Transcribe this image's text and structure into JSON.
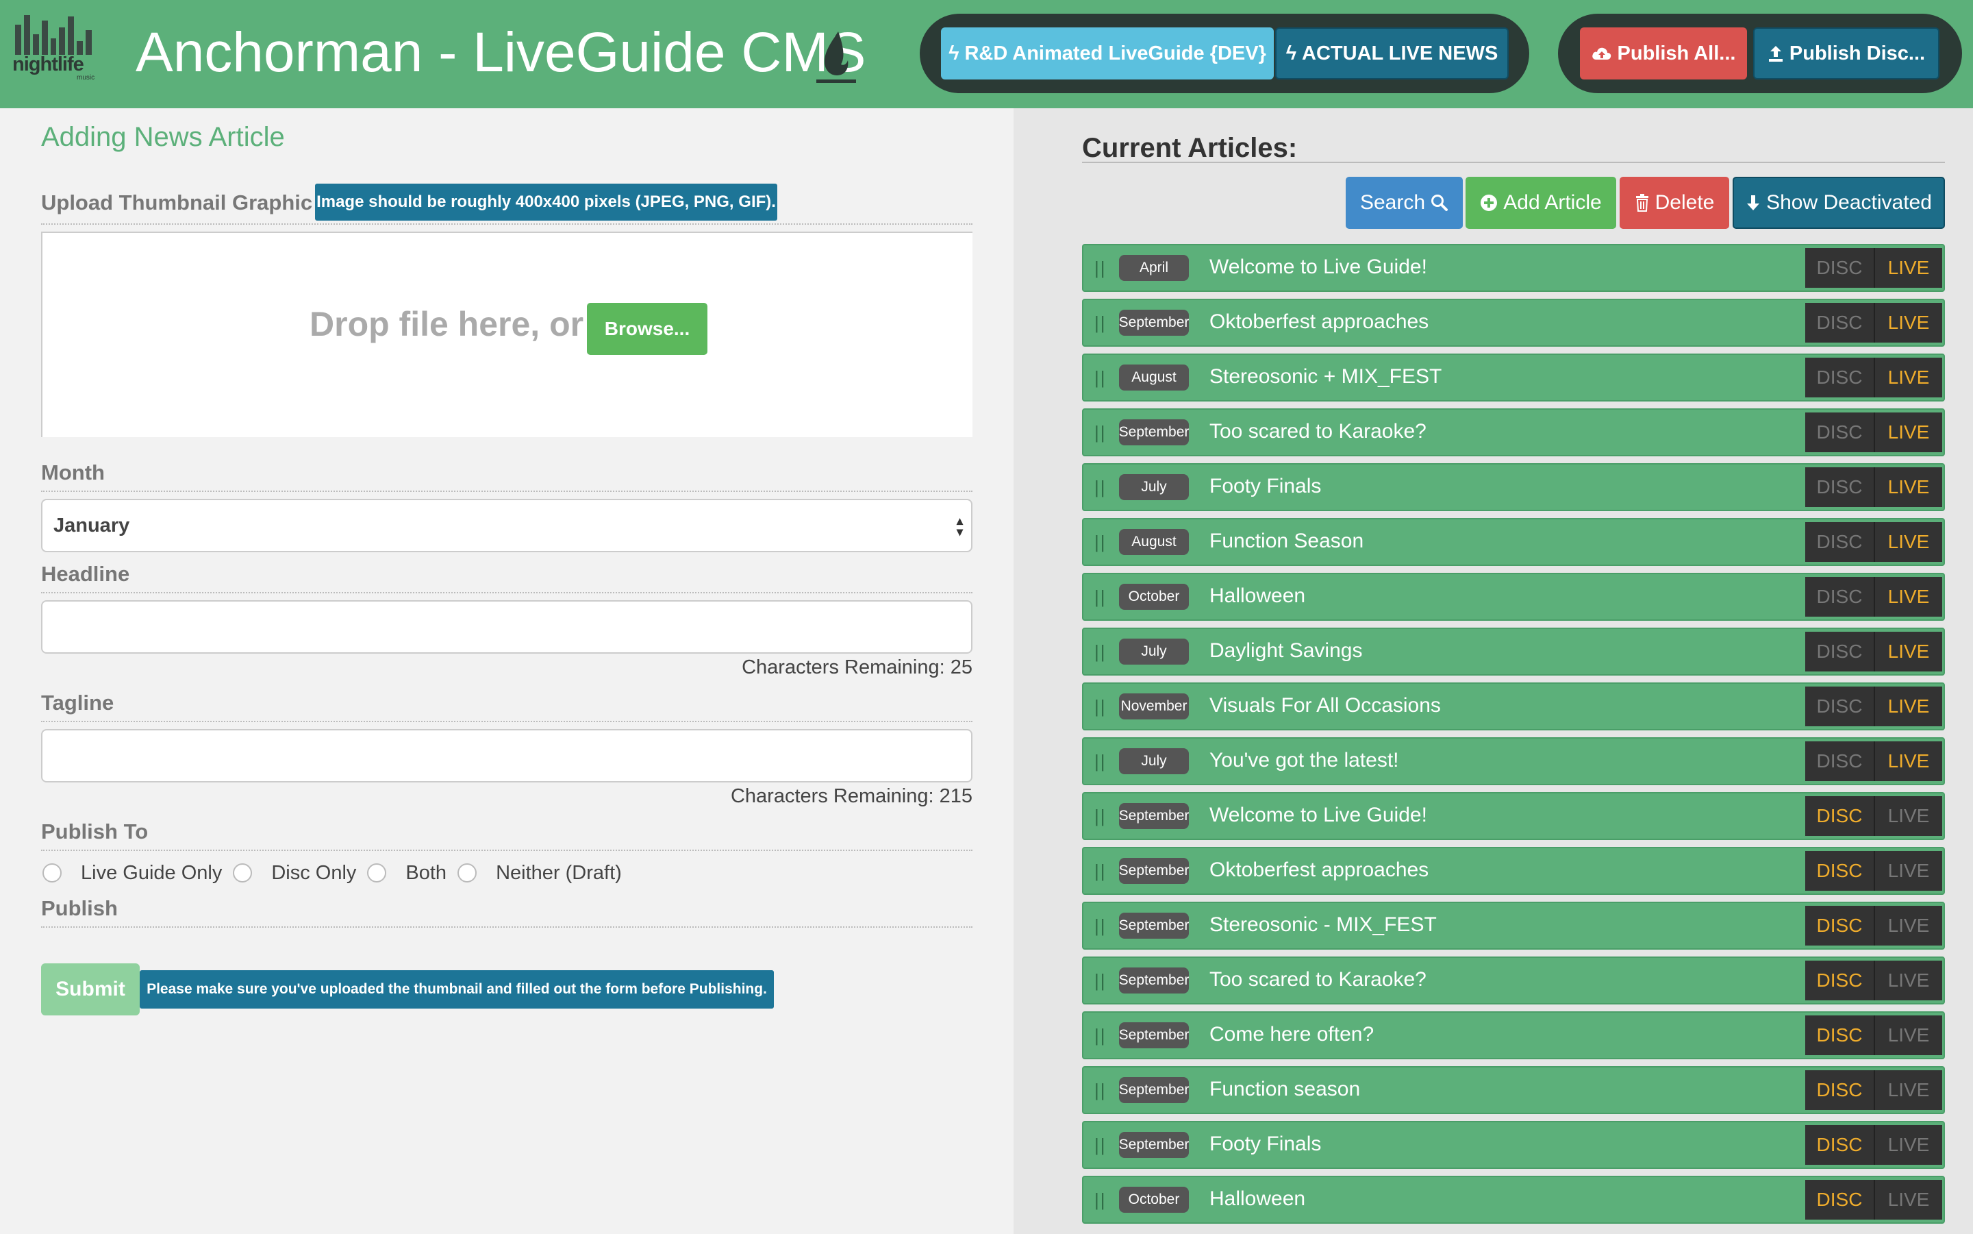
{
  "header": {
    "logo_word": "nightlife",
    "logo_sub": "music",
    "title": "Anchorman - LiveGuide CMS",
    "btn_rd": "R&D Animated LiveGuide {DEV}",
    "btn_live": "ACTUAL LIVE NEWS",
    "btn_publish_all": "Publish All...",
    "btn_publish_disc": "Publish Disc..."
  },
  "form": {
    "title": "Adding News Article",
    "thumb_label": "Upload Thumbnail Graphic",
    "thumb_tip": "Image should be roughly 400x400 pixels (JPEG, PNG, GIF).",
    "drop_text": "Drop file here, or",
    "browse_label": "Browse...",
    "month_label": "Month",
    "month_value": "January",
    "headline_label": "Headline",
    "headline_remaining": "Characters Remaining: 25",
    "tagline_label": "Tagline",
    "tagline_remaining": "Characters Remaining: 215",
    "publish_to_label": "Publish To",
    "options": [
      "Live Guide Only",
      "Disc Only",
      "Both",
      "Neither (Draft)"
    ],
    "publish_label": "Publish",
    "submit_label": "Submit",
    "submit_tip": "Please make sure you've uploaded the thumbnail and filled out the form before Publishing."
  },
  "articles_panel": {
    "title": "Current Articles:",
    "search": "Search",
    "add": "Add Article",
    "delete": "Delete",
    "show_deactivated": "Show Deactivated",
    "disc_label": "DISC",
    "live_label": "LIVE",
    "items": [
      {
        "month": "April",
        "headline": "Welcome to Live Guide!",
        "disc": false,
        "live": true
      },
      {
        "month": "September",
        "headline": "Oktoberfest approaches",
        "disc": false,
        "live": true
      },
      {
        "month": "August",
        "headline": "Stereosonic + MIX_FEST",
        "disc": false,
        "live": true
      },
      {
        "month": "September",
        "headline": "Too scared to Karaoke?",
        "disc": false,
        "live": true
      },
      {
        "month": "July",
        "headline": "Footy Finals",
        "disc": false,
        "live": true
      },
      {
        "month": "August",
        "headline": "Function Season",
        "disc": false,
        "live": true
      },
      {
        "month": "October",
        "headline": "Halloween",
        "disc": false,
        "live": true
      },
      {
        "month": "July",
        "headline": "Daylight Savings",
        "disc": false,
        "live": true
      },
      {
        "month": "November",
        "headline": "Visuals For All Occasions",
        "disc": false,
        "live": true
      },
      {
        "month": "July",
        "headline": "You've got the latest!",
        "disc": false,
        "live": true
      },
      {
        "month": "September",
        "headline": "Welcome to Live Guide!",
        "disc": true,
        "live": false
      },
      {
        "month": "September",
        "headline": "Oktoberfest approaches",
        "disc": true,
        "live": false
      },
      {
        "month": "September",
        "headline": "Stereosonic - MIX_FEST",
        "disc": true,
        "live": false
      },
      {
        "month": "September",
        "headline": "Too scared to Karaoke?",
        "disc": true,
        "live": false
      },
      {
        "month": "September",
        "headline": "Come here often?",
        "disc": true,
        "live": false
      },
      {
        "month": "September",
        "headline": "Function season",
        "disc": true,
        "live": false
      },
      {
        "month": "September",
        "headline": "Footy Finals",
        "disc": true,
        "live": false
      },
      {
        "month": "October",
        "headline": "Halloween",
        "disc": true,
        "live": false
      }
    ]
  },
  "colors": {
    "brand_green": "#5cb07a",
    "status_on": "#f0ad2c",
    "status_off": "#777777"
  }
}
